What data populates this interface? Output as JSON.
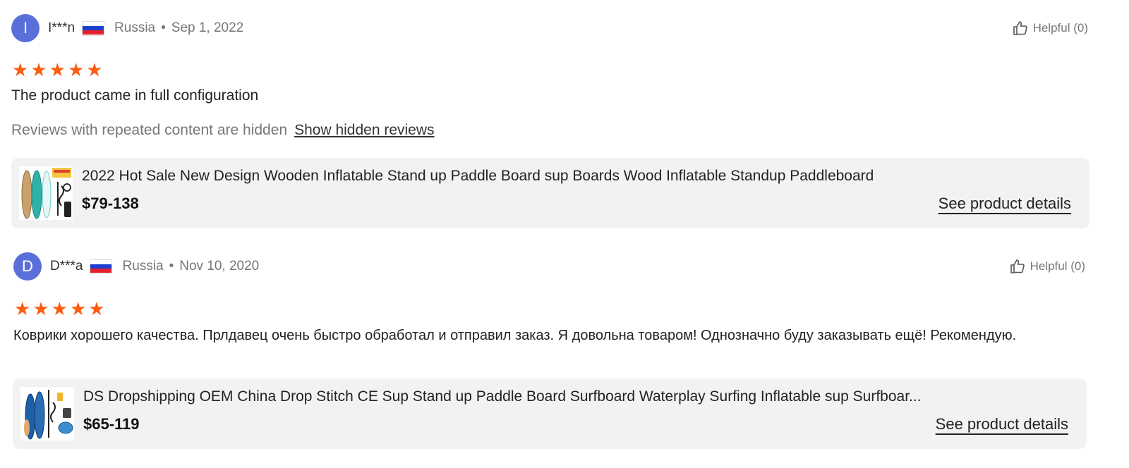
{
  "reviews": [
    {
      "avatar_letter": "I",
      "name": "I***n",
      "country": "Russia",
      "separator": "•",
      "date": "Sep 1, 2022",
      "rating": 5,
      "helpful_label": "Helpful (0)",
      "text": "The product came in full configuration",
      "hidden_notice": "Reviews with repeated content are hidden",
      "show_hidden_label": "Show hidden reviews",
      "product": {
        "title": "2022 Hot Sale New Design Wooden Inflatable Stand up Paddle Board sup Boards Wood Inflatable Standup Paddleboard",
        "price": "$79-138",
        "details_label": "See product details"
      }
    },
    {
      "avatar_letter": "D",
      "name": "D***a",
      "country": "Russia",
      "separator": "•",
      "date": "Nov 10, 2020",
      "rating": 5,
      "helpful_label": "Helpful (0)",
      "text": "Коврики хорошего качества. Прлдавец очень быстро обработал и отправил заказ. Я довольна товаром! Однозначно буду заказывать ещё! Рекомендую.",
      "product": {
        "title": "DS Dropshipping OEM China Drop Stitch CE Sup Stand up Paddle Board Surfboard Waterplay Surfing Inflatable sup Surfboar...",
        "price": "$65-119",
        "details_label": "See product details"
      }
    }
  ],
  "colors": {
    "avatar": "#5b6fd9",
    "star": "#fd5d10",
    "muted_text": "#767676",
    "card_bg": "#f2f2f2"
  },
  "icons": {
    "helpful": "thumbs-up-icon",
    "star": "star-icon",
    "flag": "russia-flag-icon"
  }
}
